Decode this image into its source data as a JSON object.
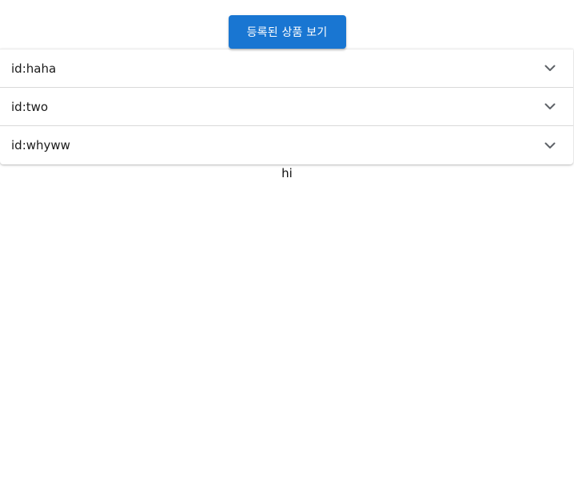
{
  "header": {
    "view_products_button": "등록된 상품 보기"
  },
  "accordion": {
    "items": [
      {
        "label": "id:haha"
      },
      {
        "label": "id:two"
      },
      {
        "label": "id:whyww"
      }
    ]
  },
  "footer_text": "hi",
  "icons": {
    "expand": "chevron-down-icon"
  },
  "colors": {
    "primary": "#1976d2",
    "divider": "#d9d9d9",
    "chevron": "#5f6368"
  }
}
